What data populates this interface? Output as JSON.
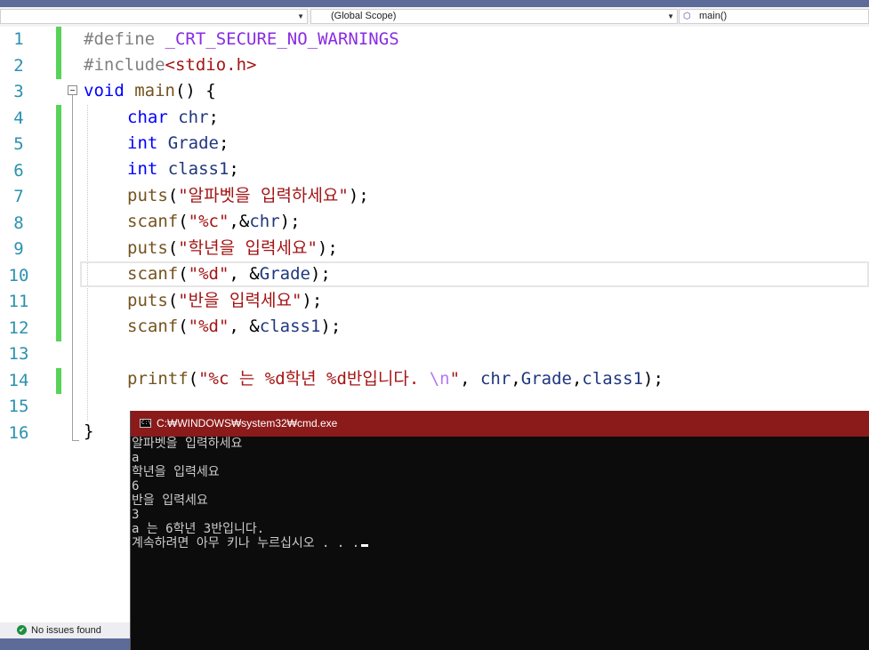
{
  "navbar": {
    "scope_label": "(Global Scope)",
    "member_label": "main()",
    "member_icon": "cube-icon"
  },
  "editor": {
    "line_numbers": [
      "1",
      "2",
      "3",
      "4",
      "5",
      "6",
      "7",
      "8",
      "9",
      "10",
      "11",
      "12",
      "13",
      "14",
      "15",
      "16"
    ],
    "lines": {
      "l1": {
        "directive": "#define",
        "macro": "_CRT_SECURE_NO_WARNINGS"
      },
      "l2": {
        "directive": "#include",
        "header": "<stdio.h>"
      },
      "l3": {
        "type": "void",
        "name": "main",
        "rest": "() {"
      },
      "l4": {
        "type": "char",
        "var": "chr",
        "end": ";"
      },
      "l5": {
        "type": "int",
        "var": "Grade",
        "end": ";"
      },
      "l6": {
        "type": "int",
        "var": "class1",
        "end": ";"
      },
      "l7": {
        "fn": "puts",
        "open": "(",
        "str": "\"알파벳을 입력하세요\"",
        "close": ");"
      },
      "l8": {
        "fn": "scanf",
        "open": "(",
        "str": "\"%c\"",
        "sep": ",&",
        "var": "chr",
        "close": ");"
      },
      "l9": {
        "fn": "puts",
        "open": "(",
        "str": "\"학년을 입력세요\"",
        "close": ");"
      },
      "l10": {
        "fn": "scanf",
        "open": "(",
        "str": "\"%d\"",
        "sep": ", &",
        "var": "Grade",
        "close": ");"
      },
      "l11": {
        "fn": "puts",
        "open": "(",
        "str": "\"반을 입력세요\"",
        "close": ");"
      },
      "l12": {
        "fn": "scanf",
        "open": "(",
        "str": "\"%d\"",
        "sep": ", &",
        "var": "class1",
        "close": ");"
      },
      "l14": {
        "fn": "printf",
        "open": "(",
        "str_a": "\"%c 는 %d학년 %d반입니다. ",
        "esc": "\\n",
        "str_b": "\"",
        "sep1": ", ",
        "v1": "chr",
        "sep2": ",",
        "v2": "Grade",
        "sep3": ",",
        "v3": "class1",
        "close": ");"
      },
      "l16": {
        "brace": "}"
      }
    }
  },
  "status": {
    "issues_label": "No issues found",
    "icon": "check-circle-icon"
  },
  "console": {
    "title": "C:₩WINDOWS₩system32₩cmd.exe",
    "icon_label": "C:\\",
    "output": [
      "알파벳을 입력하세요",
      "a",
      "학년을 입력세요",
      "6",
      "반을 입력세요",
      "3",
      "a 는 6학년 3반입니다.",
      "계속하려면 아무 키나 누르십시오 . . ."
    ]
  }
}
